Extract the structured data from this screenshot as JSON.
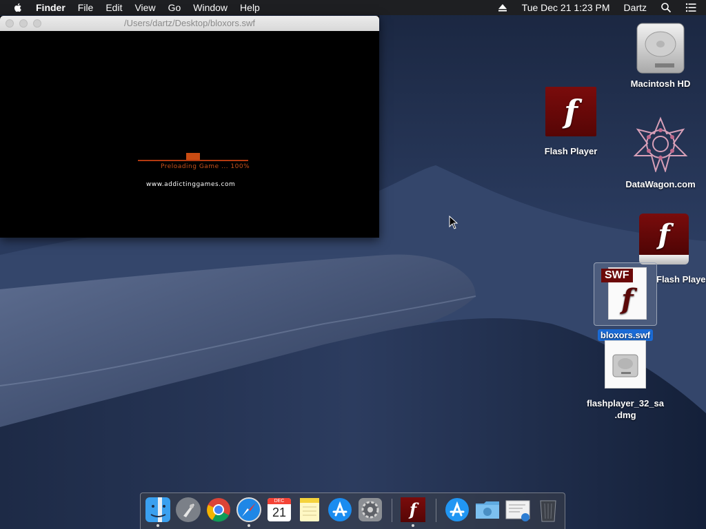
{
  "menubar": {
    "app": "Finder",
    "items": [
      "File",
      "Edit",
      "View",
      "Go",
      "Window",
      "Help"
    ],
    "datetime": "Tue Dec 21  1:23 PM",
    "user": "Dartz"
  },
  "flash_window": {
    "title": "/Users/dartz/Desktop/bloxors.swf",
    "preload_text": "Preloading Game ... 100%",
    "progress_fraction": 1.0,
    "site": "www.addictinggames.com"
  },
  "desktop": {
    "icons": {
      "macintosh_hd": "Macintosh HD",
      "flash_player_app": "Flash Player",
      "datawagon": "DataWagon.com",
      "flash_player_volume": "Flash Player",
      "bloxors_file": "bloxors.swf",
      "swf_badge": "SWF",
      "dmg_line1": "flashplayer_32_sa",
      "dmg_line2": ".dmg"
    }
  },
  "dock": {
    "calendar_month": "DEC",
    "calendar_day": "21",
    "items": [
      "finder-icon",
      "launchpad-icon",
      "chrome-icon",
      "safari-icon",
      "calendar-icon",
      "notes-icon",
      "app-store-icon",
      "system-preferences-icon",
      "flash-player-icon",
      "app-store-folder-icon",
      "downloads-folder-icon",
      "preview-icon",
      "trash-icon"
    ]
  },
  "colors": {
    "menubar": "#1e1f22",
    "flash_red": "#6b0909",
    "preload_orange": "#c8501a",
    "selection_blue": "#1a6bd6"
  }
}
